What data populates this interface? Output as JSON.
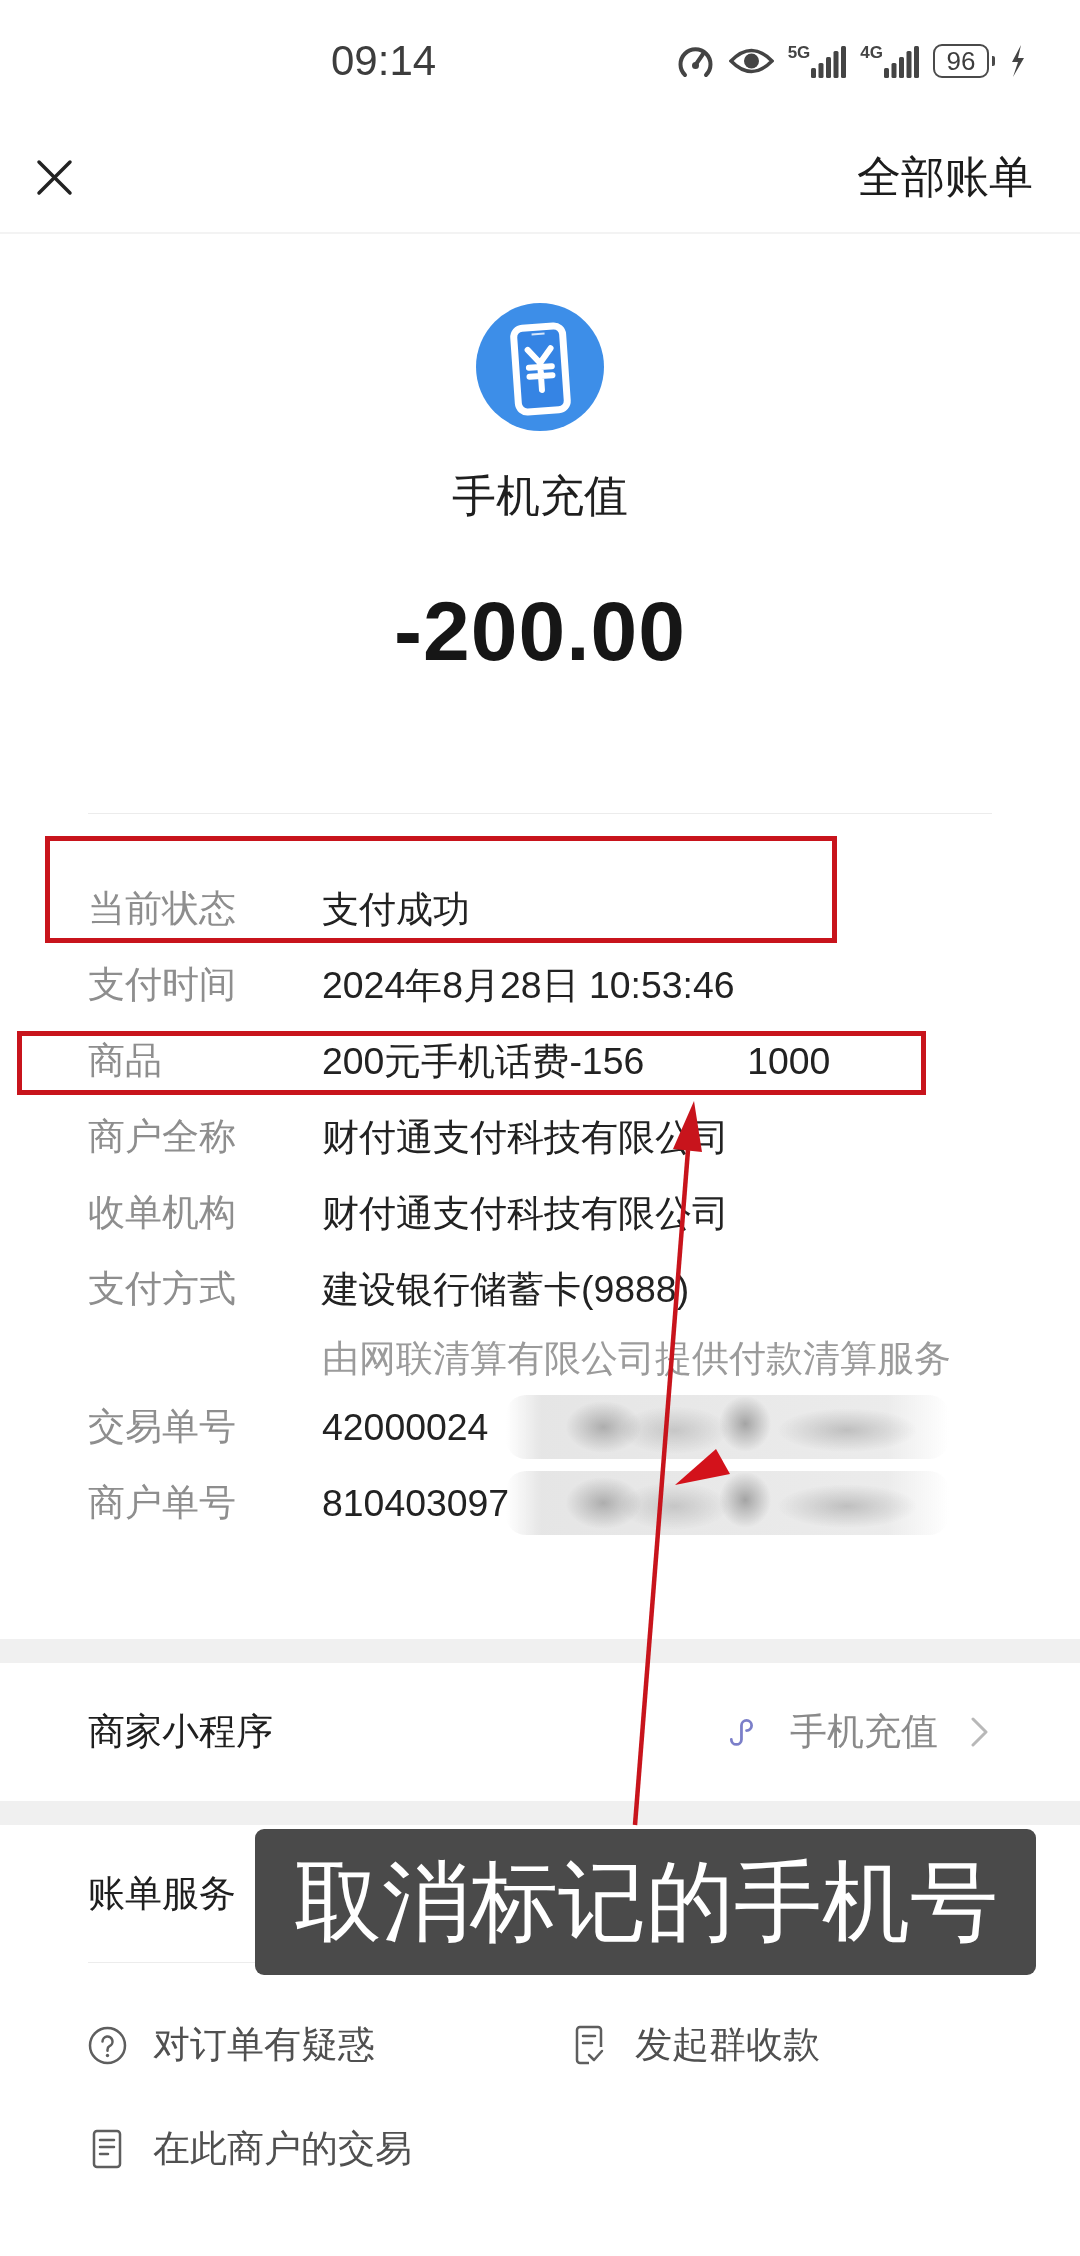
{
  "status_bar": {
    "time": "09:14",
    "networks": [
      {
        "label": "5G"
      },
      {
        "label": "4G"
      }
    ],
    "battery": "96",
    "charging": true
  },
  "header": {
    "action": "全部账单"
  },
  "summary": {
    "title": "手机充值",
    "amount": "-200.00"
  },
  "details": [
    {
      "label": "当前状态",
      "value": "支付成功",
      "redacted": false
    },
    {
      "label": "支付时间",
      "value": "2024年8月28日 10:53:46",
      "redacted": false
    },
    {
      "label": "商品",
      "value": "200元手机话费-156",
      "tail": "1000",
      "redacted": false
    },
    {
      "label": "商户全称",
      "value": "财付通支付科技有限公司",
      "redacted": false
    },
    {
      "label": "收单机构",
      "value": "财付通支付科技有限公司",
      "redacted": false
    },
    {
      "label": "支付方式",
      "value": "建设银行储蓄卡(9888)",
      "note": "由网联清算有限公司提供付款清算服务",
      "redacted": false
    },
    {
      "label": "交易单号",
      "value": "42000024",
      "redacted": true
    },
    {
      "label": "商户单号",
      "value": "810403097",
      "redacted": true
    }
  ],
  "mini_program": {
    "label": "商家小程序",
    "name": "手机充值"
  },
  "bill_services": {
    "title": "账单服务",
    "items": [
      {
        "kind": "question",
        "label": "对订单有疑惑"
      },
      {
        "kind": "group_collect",
        "label": "发起群收款"
      },
      {
        "kind": "merchant_trades",
        "label": "在此商户的交易"
      }
    ]
  },
  "annotations": [
    {
      "kind": "frame"
    },
    {
      "kind": "frame"
    },
    {
      "kind": "arrow"
    },
    {
      "kind": "arrowhead"
    },
    {
      "kind": "caption",
      "text": "取消标记的手机号"
    }
  ]
}
